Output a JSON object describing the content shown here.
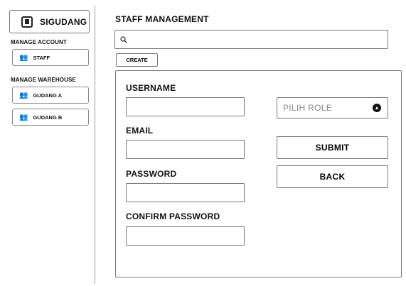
{
  "sidebar": {
    "brand": {
      "label": "SIGUDANG",
      "icon": "warehouse-icon"
    },
    "sections": [
      {
        "label": "MANAGE ACCOUNT",
        "items": [
          {
            "label": "STAFF",
            "icon": "users-icon"
          }
        ]
      },
      {
        "label": "MANAGE WAREHOUSE",
        "items": [
          {
            "label": "GUDANG A",
            "icon": "users-icon"
          },
          {
            "label": "GUDANG B",
            "icon": "users-icon"
          }
        ]
      }
    ]
  },
  "main": {
    "title": "STAFF MANAGEMENT",
    "search": {
      "value": "",
      "placeholder": "",
      "icon": "search-icon"
    },
    "create_label": "CREATE"
  },
  "form": {
    "username": {
      "label": "USERNAME",
      "value": ""
    },
    "email": {
      "label": "EMAIL",
      "value": ""
    },
    "password": {
      "label": "PASSWORD",
      "value": ""
    },
    "confirm_password": {
      "label": "CONFIRM PASSWORD",
      "value": ""
    },
    "role": {
      "placeholder": "PILIH ROLE",
      "icon": "chevron-circle-icon"
    },
    "submit_label": "SUBMIT",
    "back_label": "BACK"
  }
}
